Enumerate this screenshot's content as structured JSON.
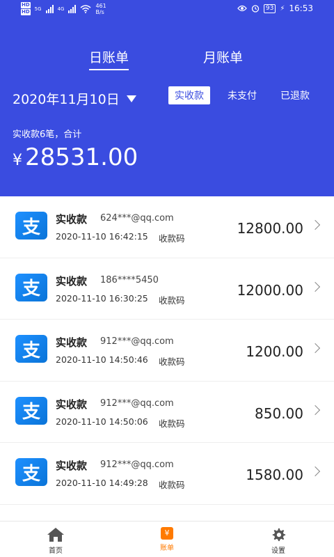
{
  "status_bar": {
    "hd1": "HD",
    "hd2": "HD",
    "sim1": "5G",
    "sim2": "4G",
    "speed_value": "461",
    "speed_unit": "B/s",
    "battery": "93",
    "time": "16:53"
  },
  "tabs": {
    "day": "日账单",
    "month": "月账单"
  },
  "date": "2020年11月10日",
  "filters": {
    "received": "实收款",
    "unpaid": "未支付",
    "refunded": "已退款",
    "active": "received"
  },
  "summary": {
    "label": "实收款6笔，合计",
    "currency": "¥",
    "amount": "28531.00"
  },
  "transactions": [
    {
      "icon_text": "支",
      "title": "实收款",
      "account": "624***@qq.com",
      "time": "2020-11-10 16:42:15",
      "method": "收款码",
      "amount": "12800.00"
    },
    {
      "icon_text": "支",
      "title": "实收款",
      "account": "186****5450",
      "time": "2020-11-10 16:30:25",
      "method": "收款码",
      "amount": "12000.00"
    },
    {
      "icon_text": "支",
      "title": "实收款",
      "account": "912***@qq.com",
      "time": "2020-11-10 14:50:46",
      "method": "收款码",
      "amount": "1200.00"
    },
    {
      "icon_text": "支",
      "title": "实收款",
      "account": "912***@qq.com",
      "time": "2020-11-10 14:50:06",
      "method": "收款码",
      "amount": "850.00"
    },
    {
      "icon_text": "支",
      "title": "实收款",
      "account": "912***@qq.com",
      "time": "2020-11-10 14:49:28",
      "method": "收款码",
      "amount": "1580.00"
    }
  ],
  "bottom_nav": {
    "home": "首页",
    "bill": "账单",
    "bill_icon_text": "¥",
    "settings": "设置",
    "active": "bill"
  },
  "colors": {
    "header_bg": "#3a4ce0",
    "alipay_blue": "#1677ff",
    "active_nav": "#ff7a00"
  },
  "icons": {
    "row_icon": "alipay-icon",
    "row_arrow": "chevron-right-icon",
    "home": "home-icon",
    "bill": "bill-yuan-icon",
    "settings": "gear-icon",
    "date_dropdown": "caret-down-icon"
  }
}
